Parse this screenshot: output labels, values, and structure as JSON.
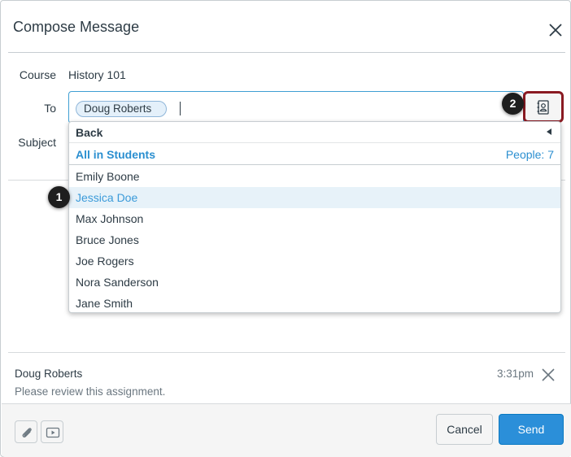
{
  "dialog": {
    "title": "Compose Message"
  },
  "form": {
    "course_label": "Course",
    "course_value": "History 101",
    "to_label": "To",
    "to_recipients": [
      "Doug Roberts"
    ],
    "subject_label": "Subject"
  },
  "dropdown": {
    "back_label": "Back",
    "group_label": "All in Students",
    "people_count": "People: 7",
    "items": [
      "Emily Boone",
      "Jessica Doe",
      "Max Johnson",
      "Bruce Jones",
      "Joe Rogers",
      "Nora Sanderson",
      "Jane Smith"
    ],
    "highlighted": "Jessica Doe"
  },
  "callouts": {
    "one": "1",
    "two": "2"
  },
  "message": {
    "author": "Doug Roberts",
    "time": "3:31pm",
    "body": "Please review this assignment."
  },
  "footer": {
    "cancel_label": "Cancel",
    "send_label": "Send"
  },
  "icons": [
    "close-icon",
    "address-book-icon",
    "attachment-icon",
    "media-icon",
    "remove-message-icon",
    "back-arrow-icon"
  ],
  "colors": {
    "accent": "#2b8fd9",
    "highlight_bg": "#e7f2f9",
    "callout_border": "#8a1a22"
  }
}
